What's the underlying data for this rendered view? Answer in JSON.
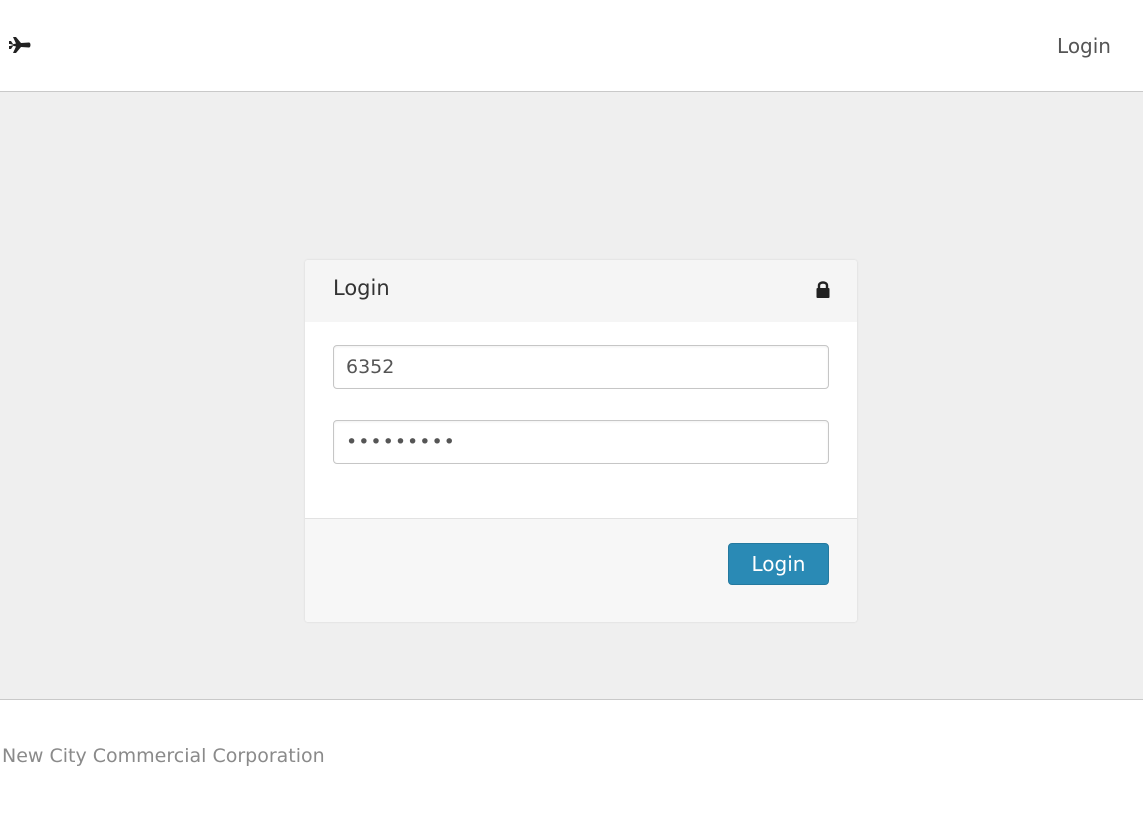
{
  "header": {
    "brand_icon": "plane-icon",
    "nav_login": "Login"
  },
  "login_panel": {
    "title": "Login",
    "title_icon": "lock-icon",
    "username_value": "6352",
    "password_value": "•••••••••",
    "submit_label": "Login",
    "accent_color": "#2a8ab5"
  },
  "footer": {
    "company": "New City Commercial Corporation"
  }
}
